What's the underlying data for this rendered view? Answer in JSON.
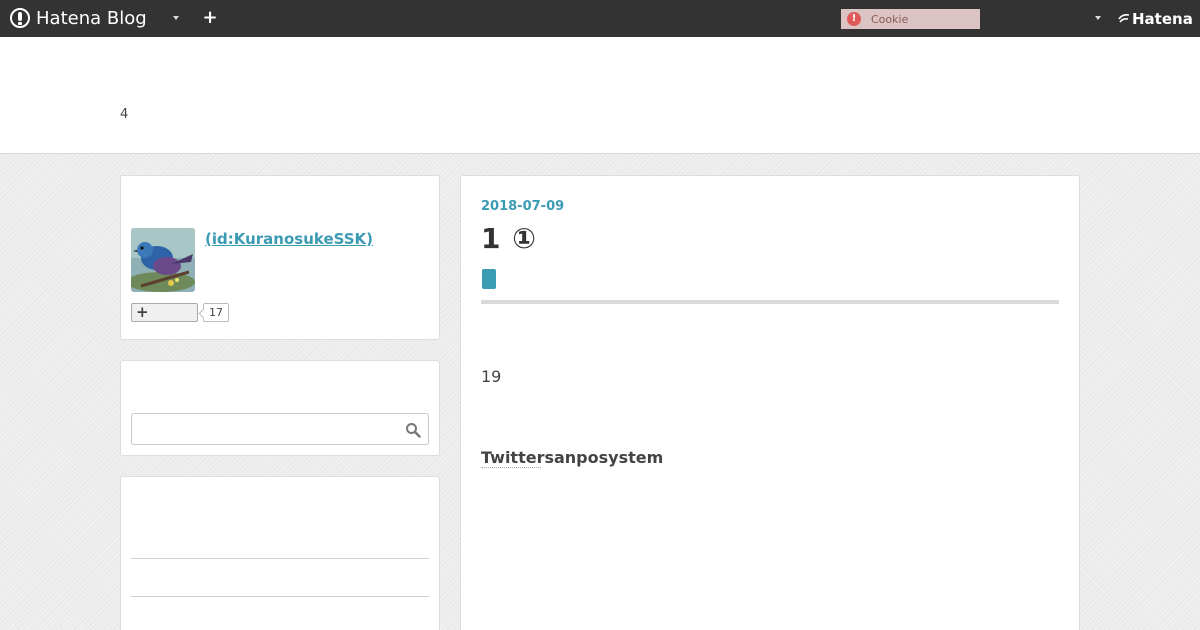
{
  "global_header": {
    "logo_text": "Hatena Blog",
    "add_symbol": "+",
    "cookie_label": "Cookie",
    "cookie_alert_symbol": "!",
    "hatena_label": "Hatena"
  },
  "blog": {
    "description": "4"
  },
  "profile": {
    "id_label": " (id:KuranosukeSSK)",
    "follow_symbol": "+",
    "follower_count": "17"
  },
  "search": {
    "placeholder": "",
    "value": ""
  },
  "entry": {
    "date": "2018-07-09",
    "title": "1 ①",
    "paragraph": "19",
    "heading": "Twittersanposystem"
  },
  "colors": {
    "header_bg": "#333333",
    "accent": "#3b9bb3",
    "cookie_bg": "#dcc4c4",
    "page_bg": "#ececec"
  },
  "icons": {
    "logo": "hatena-blog-logo-icon",
    "menu": "caret-down-icon",
    "add": "plus-icon",
    "cookie_alert": "exclamation-icon",
    "search": "magnifier-icon"
  }
}
